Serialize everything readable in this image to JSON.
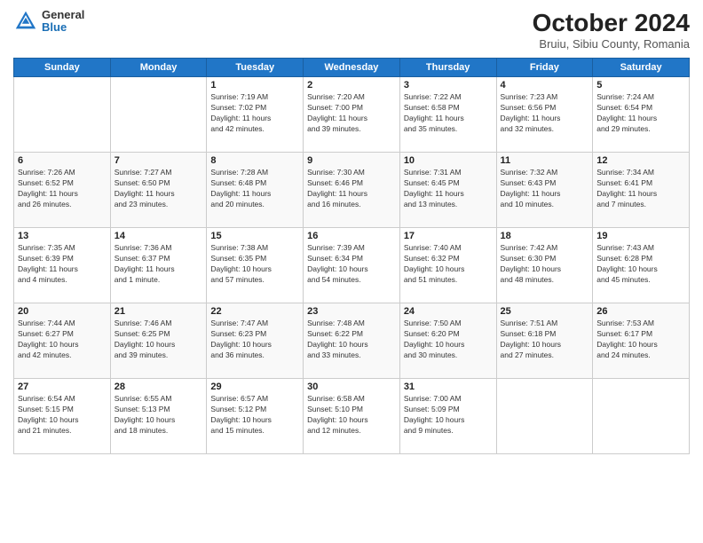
{
  "header": {
    "logo_general": "General",
    "logo_blue": "Blue",
    "title": "October 2024",
    "subtitle": "Bruiu, Sibiu County, Romania"
  },
  "days_of_week": [
    "Sunday",
    "Monday",
    "Tuesday",
    "Wednesday",
    "Thursday",
    "Friday",
    "Saturday"
  ],
  "weeks": [
    {
      "row_class": "row-odd",
      "cells": [
        {
          "day": "",
          "empty": true
        },
        {
          "day": "",
          "empty": true
        },
        {
          "day": "1",
          "line1": "Sunrise: 7:19 AM",
          "line2": "Sunset: 7:02 PM",
          "line3": "Daylight: 11 hours",
          "line4": "and 42 minutes."
        },
        {
          "day": "2",
          "line1": "Sunrise: 7:20 AM",
          "line2": "Sunset: 7:00 PM",
          "line3": "Daylight: 11 hours",
          "line4": "and 39 minutes."
        },
        {
          "day": "3",
          "line1": "Sunrise: 7:22 AM",
          "line2": "Sunset: 6:58 PM",
          "line3": "Daylight: 11 hours",
          "line4": "and 35 minutes."
        },
        {
          "day": "4",
          "line1": "Sunrise: 7:23 AM",
          "line2": "Sunset: 6:56 PM",
          "line3": "Daylight: 11 hours",
          "line4": "and 32 minutes."
        },
        {
          "day": "5",
          "line1": "Sunrise: 7:24 AM",
          "line2": "Sunset: 6:54 PM",
          "line3": "Daylight: 11 hours",
          "line4": "and 29 minutes."
        }
      ]
    },
    {
      "row_class": "row-even",
      "cells": [
        {
          "day": "6",
          "line1": "Sunrise: 7:26 AM",
          "line2": "Sunset: 6:52 PM",
          "line3": "Daylight: 11 hours",
          "line4": "and 26 minutes."
        },
        {
          "day": "7",
          "line1": "Sunrise: 7:27 AM",
          "line2": "Sunset: 6:50 PM",
          "line3": "Daylight: 11 hours",
          "line4": "and 23 minutes."
        },
        {
          "day": "8",
          "line1": "Sunrise: 7:28 AM",
          "line2": "Sunset: 6:48 PM",
          "line3": "Daylight: 11 hours",
          "line4": "and 20 minutes."
        },
        {
          "day": "9",
          "line1": "Sunrise: 7:30 AM",
          "line2": "Sunset: 6:46 PM",
          "line3": "Daylight: 11 hours",
          "line4": "and 16 minutes."
        },
        {
          "day": "10",
          "line1": "Sunrise: 7:31 AM",
          "line2": "Sunset: 6:45 PM",
          "line3": "Daylight: 11 hours",
          "line4": "and 13 minutes."
        },
        {
          "day": "11",
          "line1": "Sunrise: 7:32 AM",
          "line2": "Sunset: 6:43 PM",
          "line3": "Daylight: 11 hours",
          "line4": "and 10 minutes."
        },
        {
          "day": "12",
          "line1": "Sunrise: 7:34 AM",
          "line2": "Sunset: 6:41 PM",
          "line3": "Daylight: 11 hours",
          "line4": "and 7 minutes."
        }
      ]
    },
    {
      "row_class": "row-odd",
      "cells": [
        {
          "day": "13",
          "line1": "Sunrise: 7:35 AM",
          "line2": "Sunset: 6:39 PM",
          "line3": "Daylight: 11 hours",
          "line4": "and 4 minutes."
        },
        {
          "day": "14",
          "line1": "Sunrise: 7:36 AM",
          "line2": "Sunset: 6:37 PM",
          "line3": "Daylight: 11 hours",
          "line4": "and 1 minute."
        },
        {
          "day": "15",
          "line1": "Sunrise: 7:38 AM",
          "line2": "Sunset: 6:35 PM",
          "line3": "Daylight: 10 hours",
          "line4": "and 57 minutes."
        },
        {
          "day": "16",
          "line1": "Sunrise: 7:39 AM",
          "line2": "Sunset: 6:34 PM",
          "line3": "Daylight: 10 hours",
          "line4": "and 54 minutes."
        },
        {
          "day": "17",
          "line1": "Sunrise: 7:40 AM",
          "line2": "Sunset: 6:32 PM",
          "line3": "Daylight: 10 hours",
          "line4": "and 51 minutes."
        },
        {
          "day": "18",
          "line1": "Sunrise: 7:42 AM",
          "line2": "Sunset: 6:30 PM",
          "line3": "Daylight: 10 hours",
          "line4": "and 48 minutes."
        },
        {
          "day": "19",
          "line1": "Sunrise: 7:43 AM",
          "line2": "Sunset: 6:28 PM",
          "line3": "Daylight: 10 hours",
          "line4": "and 45 minutes."
        }
      ]
    },
    {
      "row_class": "row-even",
      "cells": [
        {
          "day": "20",
          "line1": "Sunrise: 7:44 AM",
          "line2": "Sunset: 6:27 PM",
          "line3": "Daylight: 10 hours",
          "line4": "and 42 minutes."
        },
        {
          "day": "21",
          "line1": "Sunrise: 7:46 AM",
          "line2": "Sunset: 6:25 PM",
          "line3": "Daylight: 10 hours",
          "line4": "and 39 minutes."
        },
        {
          "day": "22",
          "line1": "Sunrise: 7:47 AM",
          "line2": "Sunset: 6:23 PM",
          "line3": "Daylight: 10 hours",
          "line4": "and 36 minutes."
        },
        {
          "day": "23",
          "line1": "Sunrise: 7:48 AM",
          "line2": "Sunset: 6:22 PM",
          "line3": "Daylight: 10 hours",
          "line4": "and 33 minutes."
        },
        {
          "day": "24",
          "line1": "Sunrise: 7:50 AM",
          "line2": "Sunset: 6:20 PM",
          "line3": "Daylight: 10 hours",
          "line4": "and 30 minutes."
        },
        {
          "day": "25",
          "line1": "Sunrise: 7:51 AM",
          "line2": "Sunset: 6:18 PM",
          "line3": "Daylight: 10 hours",
          "line4": "and 27 minutes."
        },
        {
          "day": "26",
          "line1": "Sunrise: 7:53 AM",
          "line2": "Sunset: 6:17 PM",
          "line3": "Daylight: 10 hours",
          "line4": "and 24 minutes."
        }
      ]
    },
    {
      "row_class": "row-odd",
      "cells": [
        {
          "day": "27",
          "line1": "Sunrise: 6:54 AM",
          "line2": "Sunset: 5:15 PM",
          "line3": "Daylight: 10 hours",
          "line4": "and 21 minutes."
        },
        {
          "day": "28",
          "line1": "Sunrise: 6:55 AM",
          "line2": "Sunset: 5:13 PM",
          "line3": "Daylight: 10 hours",
          "line4": "and 18 minutes."
        },
        {
          "day": "29",
          "line1": "Sunrise: 6:57 AM",
          "line2": "Sunset: 5:12 PM",
          "line3": "Daylight: 10 hours",
          "line4": "and 15 minutes."
        },
        {
          "day": "30",
          "line1": "Sunrise: 6:58 AM",
          "line2": "Sunset: 5:10 PM",
          "line3": "Daylight: 10 hours",
          "line4": "and 12 minutes."
        },
        {
          "day": "31",
          "line1": "Sunrise: 7:00 AM",
          "line2": "Sunset: 5:09 PM",
          "line3": "Daylight: 10 hours",
          "line4": "and 9 minutes."
        },
        {
          "day": "",
          "empty": true
        },
        {
          "day": "",
          "empty": true
        }
      ]
    }
  ]
}
